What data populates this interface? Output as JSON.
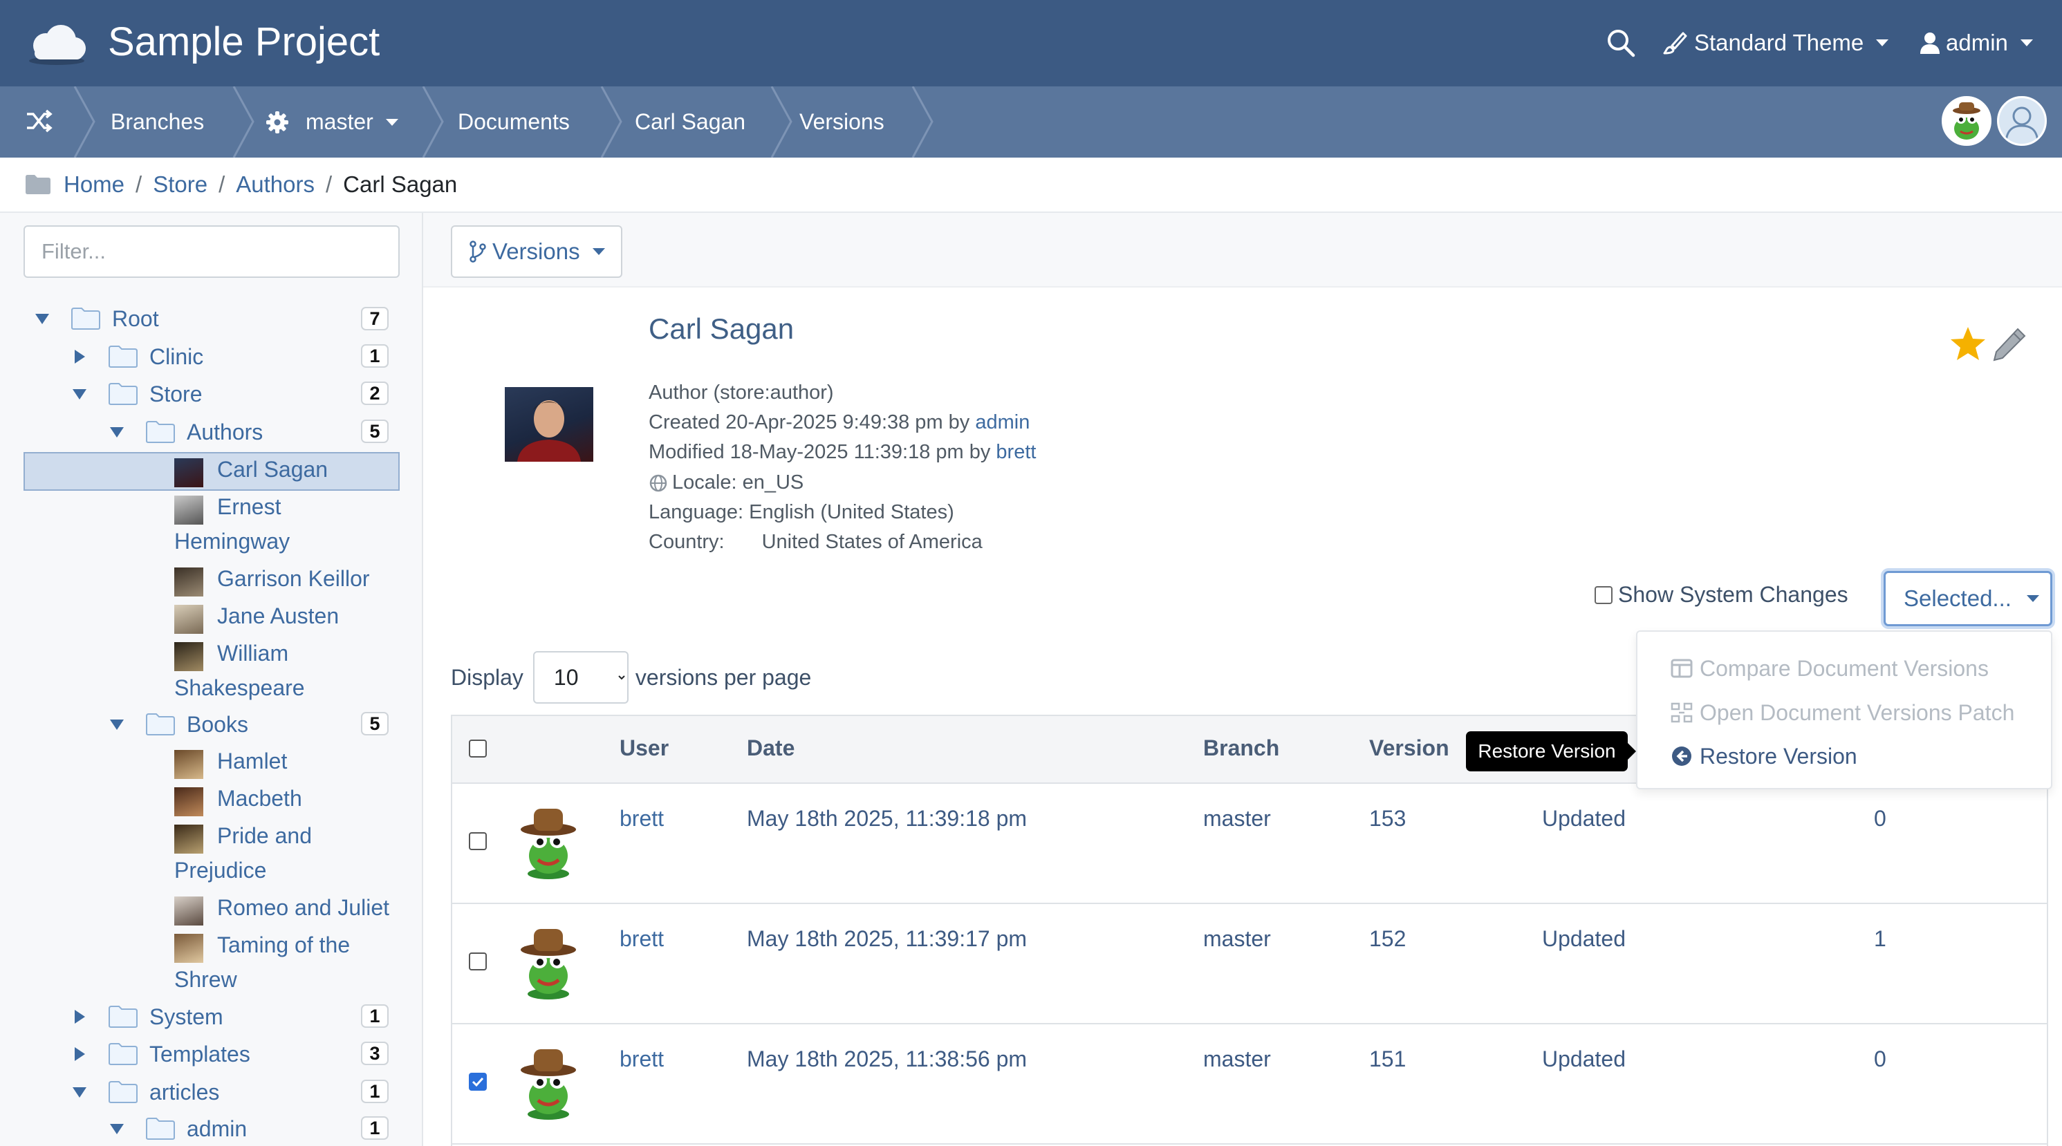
{
  "topbar": {
    "project_title": "Sample Project",
    "theme_label": "Standard Theme",
    "user_label": "admin"
  },
  "branchbar": {
    "crumbs": [
      "Branches",
      "master",
      "Documents",
      "Carl Sagan",
      "Versions"
    ]
  },
  "path": {
    "items": [
      "Home",
      "Store",
      "Authors"
    ],
    "current": "Carl Sagan"
  },
  "sidebar": {
    "filter_placeholder": "Filter...",
    "tree": {
      "root": {
        "label": "Root",
        "count": "7"
      },
      "clinic": {
        "label": "Clinic",
        "count": "1"
      },
      "store": {
        "label": "Store",
        "count": "2"
      },
      "authors": {
        "label": "Authors",
        "count": "5"
      },
      "author_items": [
        {
          "l1": "Carl Sagan",
          "l2": ""
        },
        {
          "l1": "Ernest",
          "l2": "Hemingway"
        },
        {
          "l1": "Garrison Keillor",
          "l2": ""
        },
        {
          "l1": "Jane Austen",
          "l2": ""
        },
        {
          "l1": "William",
          "l2": "Shakespeare"
        }
      ],
      "books": {
        "label": "Books",
        "count": "5"
      },
      "book_items": [
        {
          "l1": "Hamlet",
          "l2": ""
        },
        {
          "l1": "Macbeth",
          "l2": ""
        },
        {
          "l1": "Pride and",
          "l2": "Prejudice"
        },
        {
          "l1": "Romeo and Juliet",
          "l2": ""
        },
        {
          "l1": "Taming of the",
          "l2": "Shrew"
        }
      ],
      "system": {
        "label": "System",
        "count": "1"
      },
      "templates": {
        "label": "Templates",
        "count": "3"
      },
      "articles": {
        "label": "articles",
        "count": "1"
      },
      "admin": {
        "label": "admin",
        "count": "1"
      }
    }
  },
  "toolbar": {
    "versions_label": "Versions"
  },
  "document": {
    "title": "Carl Sagan",
    "type_line": "Author (store:author)",
    "created_prefix": "Created 20-Apr-2025 9:49:38 pm by",
    "created_by": "admin",
    "modified_prefix": "Modified 18-May-2025 11:39:18 pm by",
    "modified_by": "brett",
    "locale": "Locale: en_US",
    "language": "Language: English (United States)",
    "country_label": "Country:",
    "country_value": "United States of America"
  },
  "versions": {
    "show_system_changes": "Show System Changes",
    "selected_label": "Selected...",
    "display_label": "Display",
    "per_page_value": "10",
    "per_page_options": [
      "10"
    ],
    "per_page_suffix": "versions per page",
    "menu": {
      "compare": "Compare Document Versions",
      "patch": "Open Document Versions Patch",
      "restore": "Restore Version"
    },
    "tooltip": "Restore Version",
    "columns": [
      "User",
      "Date",
      "Branch",
      "Version"
    ],
    "rows": [
      {
        "user": "brett",
        "date": "May 18th 2025, 11:39:18 pm",
        "branch": "master",
        "version": "153",
        "action": "Updated",
        "count": "0",
        "checked": false
      },
      {
        "user": "brett",
        "date": "May 18th 2025, 11:39:17 pm",
        "branch": "master",
        "version": "152",
        "action": "Updated",
        "count": "1",
        "checked": false
      },
      {
        "user": "brett",
        "date": "May 18th 2025, 11:38:56 pm",
        "branch": "master",
        "version": "151",
        "action": "Updated",
        "count": "0",
        "checked": true
      }
    ]
  },
  "colors": {
    "topbar": "#3c5a83",
    "branchbar": "#5a769c",
    "link": "#3d6aa0",
    "star": "#f5b100",
    "checkbox_checked": "#2a6fdb"
  },
  "icons": [
    "cloud-logo-icon",
    "search-icon",
    "brush-icon",
    "user-icon",
    "shuffle-icon",
    "gear-icon",
    "folder-icon",
    "star-icon",
    "pencil-icon",
    "branch-icon",
    "globe-icon",
    "compare-icon",
    "patch-icon",
    "restore-icon",
    "frog-avatar-icon"
  ]
}
